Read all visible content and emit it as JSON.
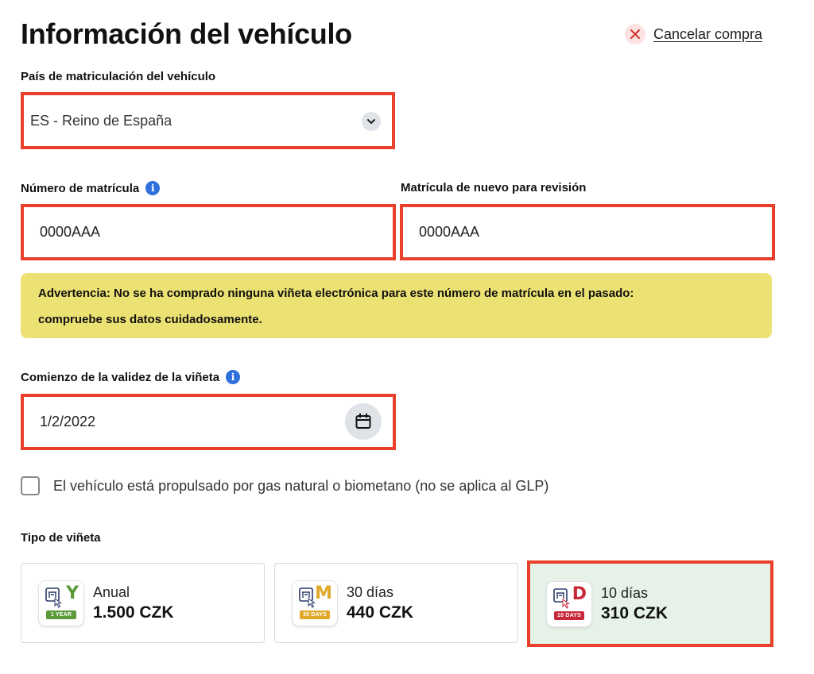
{
  "header": {
    "title": "Información del vehículo",
    "cancel_label": "Cancelar compra"
  },
  "country": {
    "label": "País de matriculación del vehículo",
    "value": "ES - Reino de España"
  },
  "plate": {
    "label": "Número de matrícula",
    "value": "0000AAA"
  },
  "plate_confirm": {
    "label": "Matrícula de nuevo para revisión",
    "value": "0000AAA"
  },
  "warning": {
    "line1": "Advertencia: No se ha comprado ninguna viñeta electrónica para este número de matrícula en el pasado:",
    "line2": "compruebe sus datos cuidadosamente."
  },
  "validity": {
    "label": "Comienzo de la validez de la viñeta",
    "value": "1/2/2022"
  },
  "gas": {
    "label": "El vehículo está propulsado por gas natural o biometano (no se aplica al GLP)",
    "checked": false
  },
  "vignette": {
    "label": "Tipo de viñeta",
    "options": [
      {
        "letter": "Y",
        "ribbon": "1 YEAR",
        "name": "Anual",
        "price": "1.500 CZK",
        "color": "#5a9a3a",
        "selected": false
      },
      {
        "letter": "M",
        "ribbon": "30 DAYS",
        "name": "30 días",
        "price": "440 CZK",
        "color": "#e0a92a",
        "selected": false
      },
      {
        "letter": "D",
        "ribbon": "10 DAYS",
        "name": "10 días",
        "price": "310 CZK",
        "color": "#c8283a",
        "selected": true
      }
    ]
  },
  "colors": {
    "accent_border": "#e8402a",
    "warning_bg": "#ece173",
    "info_blue": "#2f6fdc",
    "selected_card_bg": "#e6f2e8"
  }
}
